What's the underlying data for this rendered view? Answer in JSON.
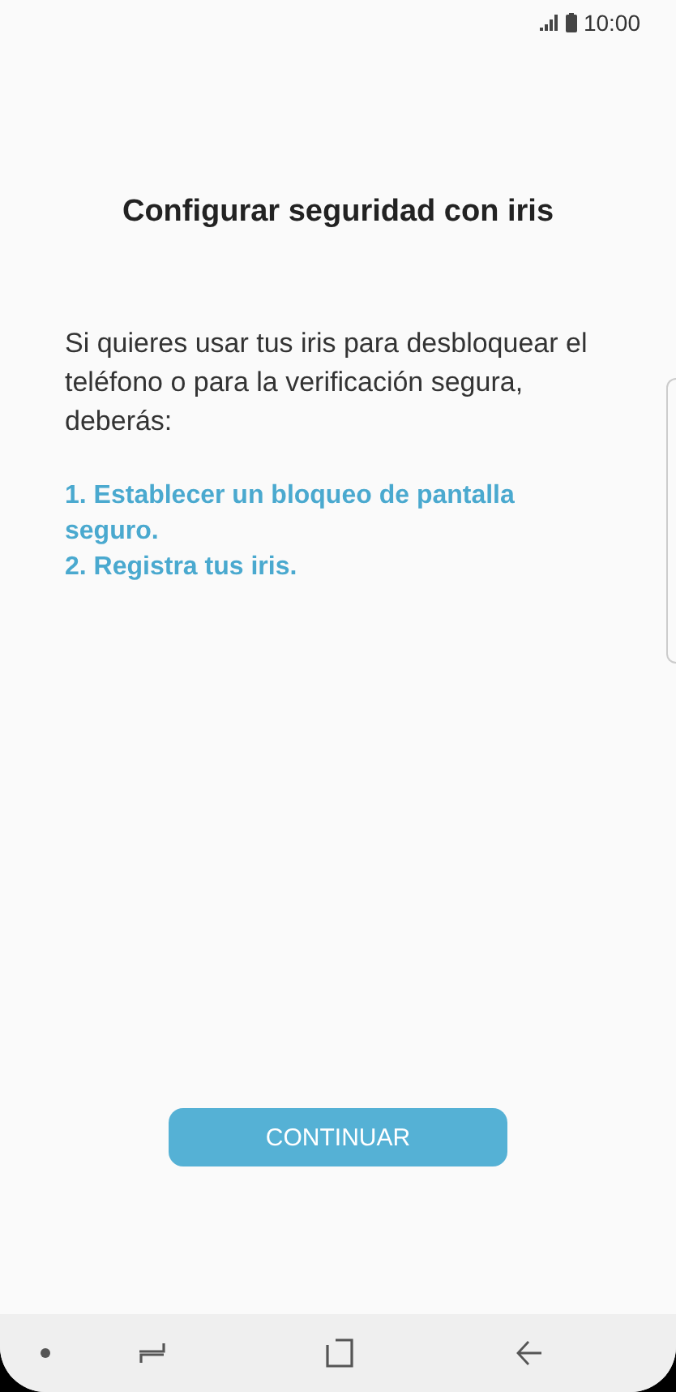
{
  "status_bar": {
    "time": "10:00"
  },
  "title": "Configurar seguridad con iris",
  "description": "Si quieres usar tus iris para desbloquear el teléfono o para la verificación segura, deberás:",
  "steps": [
    "1. Establecer un bloqueo de pantalla seguro.",
    "2. Registra tus iris."
  ],
  "button": "CONTINUAR"
}
